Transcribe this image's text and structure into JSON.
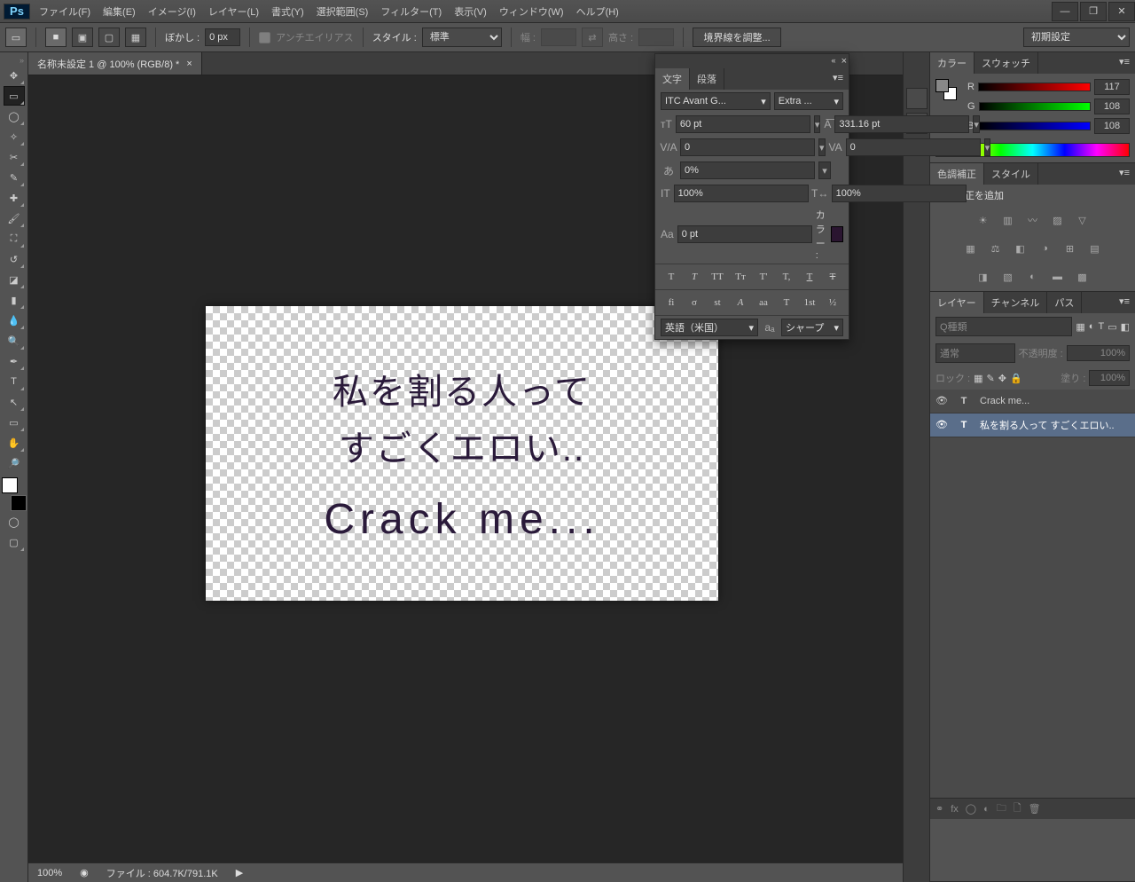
{
  "app": {
    "logo": "Ps"
  },
  "menu": [
    "ファイル(F)",
    "編集(E)",
    "イメージ(I)",
    "レイヤー(L)",
    "書式(Y)",
    "選択範囲(S)",
    "フィルター(T)",
    "表示(V)",
    "ウィンドウ(W)",
    "ヘルプ(H)"
  ],
  "optbar": {
    "feather_label": "ぼかし :",
    "feather_value": "0 px",
    "antialias": "アンチエイリアス",
    "style_label": "スタイル :",
    "style_value": "標準",
    "width_label": "幅 :",
    "height_label": "高さ :",
    "refine_edge": "境界線を調整...",
    "workspace": "初期設定"
  },
  "doc": {
    "tab_title": "名称未設定 1 @ 100% (RGB/8) *",
    "canvas_text_jp": "私を割る人って\nすごくエロい..",
    "canvas_text_en": "Crack me..."
  },
  "status": {
    "zoom": "100%",
    "file": "ファイル : 604.7K/791.1K"
  },
  "char_panel": {
    "tab_char": "文字",
    "tab_para": "段落",
    "font": "ITC Avant G...",
    "weight": "Extra ...",
    "size": "60 pt",
    "leading": "331.16 pt",
    "kerning": "0",
    "tracking": "0",
    "tsume": "0%",
    "vscale": "100%",
    "hscale": "100%",
    "baseline": "0 pt",
    "color_label": "カラー :",
    "lang": "英語（米国）",
    "aa": "シャープ",
    "btns1": [
      "T",
      "T",
      "TT",
      "Tт",
      "T'",
      "T,",
      "T",
      "Ŧ"
    ],
    "btns2": [
      "fi",
      "σ",
      "st",
      "A",
      "aa",
      "T",
      "1st",
      "½"
    ]
  },
  "color_panel": {
    "tabs": [
      "カラー",
      "スウォッチ"
    ],
    "r": "117",
    "g": "108",
    "b": "108",
    "r_label": "R",
    "g_label": "G",
    "b_label": "B"
  },
  "adjust_panel": {
    "tabs": [
      "色調補正",
      "スタイル"
    ],
    "hint": "色調補正を追加"
  },
  "layers_panel": {
    "tabs": [
      "レイヤー",
      "チャンネル",
      "パス"
    ],
    "kind": "Q種類",
    "blend": "通常",
    "opacity_label": "不透明度 :",
    "opacity": "100%",
    "lock_label": "ロック :",
    "fill_label": "塗り :",
    "fill": "100%",
    "layers": [
      {
        "name": "Crack me...",
        "type": "T"
      },
      {
        "name": "私を割る人って すごくエロい..",
        "type": "T"
      }
    ]
  }
}
